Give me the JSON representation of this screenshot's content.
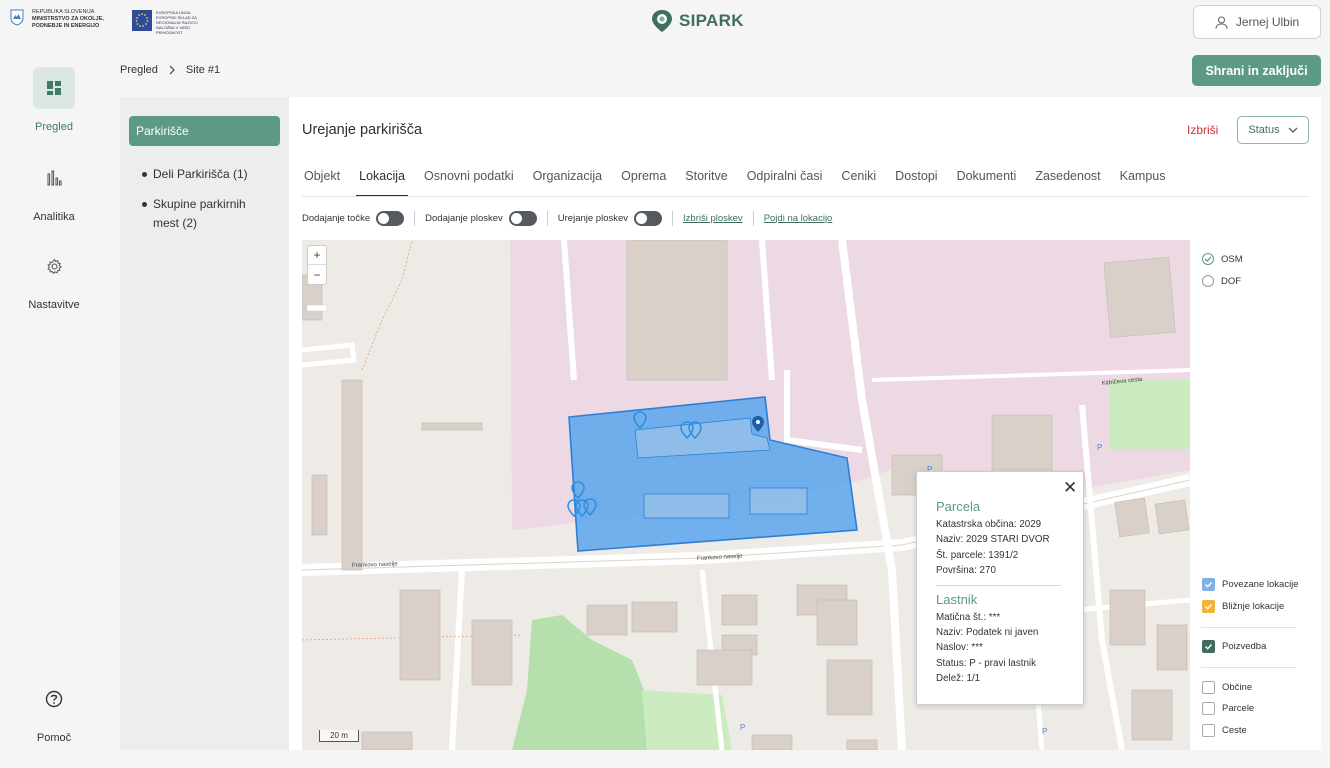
{
  "header": {
    "gov_line1": "REPUBLIKA SLOVENIJA",
    "gov_line2": "MINISTRSTVO ZA OKOLJE,",
    "gov_line3": "PODNEBJE IN ENERGIJO",
    "eu_line1": "EVROPSKA UNIJA",
    "eu_line2": "EVROPSKI SKLAD ZA REGIONALNI RAZVOJ",
    "eu_line3": "NALOŽBA V VAŠO PRIHODNOST",
    "brand": "SIPARK",
    "user_name": "Jernej Ulbin"
  },
  "nav": {
    "items": [
      {
        "label": "Pregled",
        "icon": "dashboard-icon",
        "active": true
      },
      {
        "label": "Analitika",
        "icon": "bar-chart-icon",
        "active": false
      },
      {
        "label": "Nastavitve",
        "icon": "gear-icon",
        "active": false
      }
    ],
    "help_label": "Pomoč"
  },
  "breadcrumb": {
    "root": "Pregled",
    "current": "Site #1"
  },
  "actions": {
    "save_label": "Shrani in zaključi",
    "delete_label": "Izbriši",
    "status_label": "Status"
  },
  "sidepanel": {
    "active": "Parkirišče",
    "items": [
      "Deli Parkirišča (1)",
      "Skupine parkirnih mest (2)"
    ]
  },
  "main": {
    "title": "Urejanje parkirišča",
    "tabs": [
      "Objekt",
      "Lokacija",
      "Osnovni podatki",
      "Organizacija",
      "Oprema",
      "Storitve",
      "Odpiralni časi",
      "Ceniki",
      "Dostopi",
      "Dokumenti",
      "Zasedenost",
      "Kampus"
    ],
    "active_tab": "Lokacija"
  },
  "toolbar": {
    "add_point": "Dodajanje točke",
    "add_area": "Dodajanje ploskev",
    "edit_area": "Urejanje ploskev",
    "delete_areas": "Izbriši ploskev",
    "go_to_location": "Pojdi na lokacijo"
  },
  "map": {
    "zoom_in": "+",
    "zoom_out": "−",
    "scale": "20 m",
    "street1": "Frankovo naselje",
    "street2": "Frankovo naselje",
    "street3": "Kidričeva cesta",
    "parking_label": "P"
  },
  "popup": {
    "parcel_title": "Parcela",
    "parcel_rows": [
      "Katastrska občina: 2029",
      "Naziv: 2029 STARI DVOR",
      "Št. parcele: 1391/2",
      "Površina: 270"
    ],
    "owner_title": "Lastnik",
    "owner_rows": [
      "Matična št.: ***",
      "Naziv: Podatek ni javen",
      "Naslov: ***",
      "Status: P - pravi lastnik",
      "Delež: 1/1"
    ]
  },
  "layers": {
    "base": [
      {
        "label": "OSM",
        "selected": true
      },
      {
        "label": "DOF",
        "selected": false
      }
    ],
    "overlays": [
      {
        "label": "Povezane lokacije",
        "checked": true,
        "color": "#7fb0e8"
      },
      {
        "label": "Bližnje lokacije",
        "checked": true,
        "color": "#f0b43c"
      }
    ],
    "query": {
      "label": "Poizvedba",
      "checked": true,
      "color": "#3f6e5e"
    },
    "extra": [
      {
        "label": "Občine",
        "checked": false
      },
      {
        "label": "Parcele",
        "checked": false
      },
      {
        "label": "Ceste",
        "checked": false
      }
    ]
  }
}
